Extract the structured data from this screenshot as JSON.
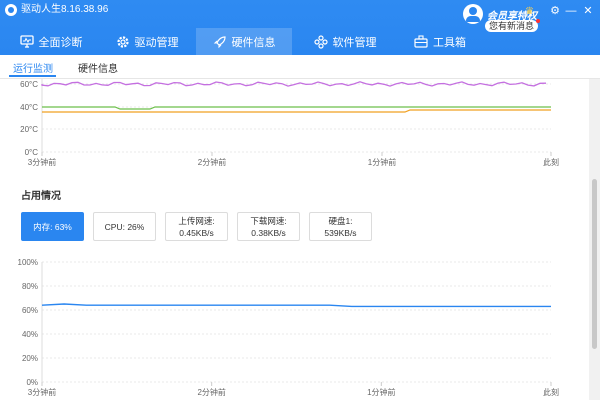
{
  "app": {
    "title": "驱动人生8.16.38.96"
  },
  "vip": {
    "label": "会员享特权",
    "news": "您有新消息"
  },
  "window": {
    "settings_glyph": "⚙",
    "minimize_glyph": "—",
    "close_glyph": "✕"
  },
  "nav": {
    "items": [
      {
        "label": "全面诊断",
        "icon": "monitor-icon"
      },
      {
        "label": "驱动管理",
        "icon": "gear-icon"
      },
      {
        "label": "硬件信息",
        "icon": "rocket-icon",
        "active": true
      },
      {
        "label": "软件管理",
        "icon": "apps-icon"
      },
      {
        "label": "工具箱",
        "icon": "toolbox-icon"
      }
    ]
  },
  "subtabs": [
    {
      "label": "运行监测",
      "active": true
    },
    {
      "label": "硬件信息"
    }
  ],
  "temp_chart": {
    "y_ticks": [
      "60°C",
      "40°C",
      "20°C",
      "0°C"
    ],
    "x_ticks": [
      "3分钟前",
      "2分钟前",
      "1分钟前",
      "此刻"
    ],
    "colors": {
      "purple": "#c46fe0",
      "green": "#6cbf4a",
      "orange": "#f0a020"
    }
  },
  "usage": {
    "title": "占用情况",
    "metrics": [
      {
        "line1": "内存: 63%",
        "line2": "",
        "active": true
      },
      {
        "line1": "CPU: 26%",
        "line2": ""
      },
      {
        "line1": "上传网速:",
        "line2": "0.45KB/s"
      },
      {
        "line1": "下载网速:",
        "line2": "0.38KB/s"
      },
      {
        "line1": "硬盘1:",
        "line2": "539KB/s"
      }
    ]
  },
  "chart_data": {
    "type": "line",
    "x_labels": [
      "3分钟前",
      "2分钟前",
      "1分钟前",
      "此刻"
    ],
    "y_ticks": [
      "100%",
      "80%",
      "60%",
      "40%",
      "20%",
      "0%"
    ],
    "ylim": [
      0,
      100
    ],
    "series": [
      {
        "color": "#2a86f0",
        "values": [
          64,
          65,
          64,
          64,
          64,
          64,
          64,
          64,
          64,
          64,
          64,
          64,
          64,
          64,
          63,
          63,
          63,
          63,
          63,
          63,
          63,
          63,
          63,
          63
        ]
      }
    ]
  }
}
